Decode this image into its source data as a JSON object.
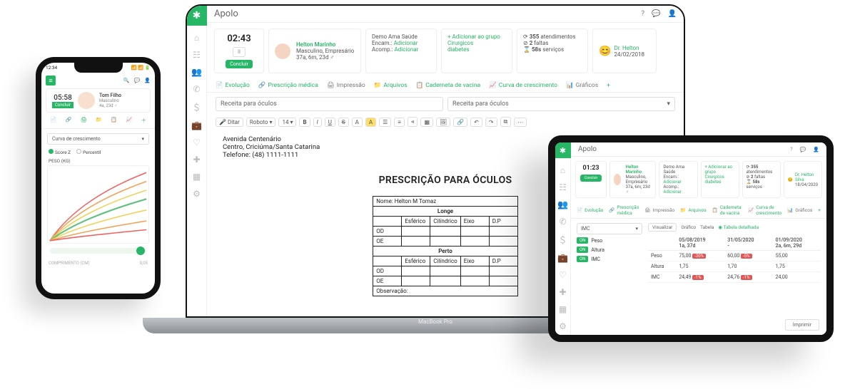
{
  "laptop": {
    "base_label": "MacBook Pro",
    "app_title": "Apolo",
    "sidebar_icons": [
      "home",
      "calendar",
      "users",
      "phone",
      "dollar",
      "briefcase",
      "heart",
      "health",
      "grid",
      "gear"
    ],
    "timer_card": {
      "time": "02:43",
      "pause": "II",
      "action": "Concluir"
    },
    "patient_card": {
      "name": "Helton Marinho",
      "details": "Masculino, Empresário",
      "age": "37a, 6m, 23d ♂"
    },
    "referral_card": {
      "l1": "Demo Ama Saúde",
      "l2a": "Encam.:",
      "l2b": "Adicionar",
      "l3a": "Acomp.:",
      "l3b": "Adicionar"
    },
    "group_card": {
      "add": "+ Adicionar ao grupo",
      "tag1": "Cirurgicos",
      "tag2": "diabetes"
    },
    "stats_card": {
      "i1": "⟳",
      "v1": "355",
      "t1": "atendimentos",
      "i2": "⊘",
      "v2": "2",
      "t2": "faltas",
      "i3": "⌛",
      "v3": "58s",
      "t3": "serviços"
    },
    "doctor_card": {
      "name": "Dr. Helton",
      "date": "24/02/2018"
    },
    "menu_tabs": {
      "evolucao": "Evolução",
      "prescricao": "Prescrição médica",
      "impressao": "Impressão",
      "arquivos": "Arquivos",
      "caderneta": "Caderneta de vacina",
      "curva": "Curva de crescimento",
      "graficos": "Gráficos",
      "add": "+"
    },
    "doc_title_input": "Receita para óculos",
    "doc_template_select": "Receita para óculos",
    "toolbar": {
      "ditar": "Ditar",
      "font": "Roboto",
      "size": "14",
      "b": "B",
      "i": "I",
      "u": "U",
      "s": "S",
      "color": "A",
      "hl": "A"
    },
    "editor": {
      "addr1": "Avenida Centenário",
      "addr2": "Centro, Criciúma/Santa Catarina",
      "phone": "Telefone: (48) 1111-1111",
      "title": "PRESCRIÇÃO PARA ÓCULOS",
      "name_label": "Nome:",
      "name_value": "Helton M Tomaz",
      "sect_longe": "Longe",
      "sect_perto": "Perto",
      "cols": {
        "esf": "Esférico",
        "cil": "Cilíndrico",
        "eixo": "Eixo",
        "dp": "D.P"
      },
      "rows": {
        "od": "OD",
        "oe": "OE"
      },
      "obs": "Observação:"
    }
  },
  "tablet": {
    "app_title": "Apolo",
    "timer_card": {
      "time": "01:23",
      "action": "Concluir"
    },
    "patient_card": {
      "name": "Helton Marinho",
      "details": "Masculino, Empresário",
      "age": "37a, 6m, 23d ♂"
    },
    "referral_card": {
      "l1": "Demo Ama Saúde",
      "l2a": "Encam.:",
      "l2b": "Adicionar",
      "l3a": "Acomp.:",
      "l3b": "Adicionar"
    },
    "group_card": {
      "add": "+ Adicionar ao grupo",
      "tag1": "Cirurgicos",
      "tag2": "diabetes"
    },
    "stats_card": {
      "v1": "355",
      "t1": "atendimentos",
      "v2": "2",
      "t2": "faltas",
      "v3": "58s",
      "t3": "serviços"
    },
    "doctor_card": {
      "name": "Dr. Helton Silva",
      "date": "18/04/2020"
    },
    "menu_tabs": {
      "evolucao": "Evolução",
      "prescricao": "Prescrição médica",
      "impressao": "Impressão",
      "arquivos": "Arquivos",
      "caderneta": "Caderneta de vacina",
      "curva": "Curva de crescimento",
      "graficos": "Gráficos",
      "add": "+"
    },
    "select_value": "IMC",
    "view_switch": {
      "visualizar": "Visualizar",
      "grafico": "Gráfico",
      "tabela": "Tabela",
      "detalhada": "Tabela detalhada"
    },
    "tags": {
      "peso": "Peso",
      "altura": "Altura",
      "imc": "IMC",
      "on": "ON"
    },
    "table": {
      "headers": [
        "",
        "05/08/2019\n1a, 37d",
        "31/05/2020\n-",
        "01/09/2020\n2a, 6m, 29d"
      ],
      "rows": [
        {
          "label": "Peso",
          "c1": "75,00",
          "d1": "-20%",
          "c2": "60,00",
          "d2": "-5%",
          "c3": "55,00"
        },
        {
          "label": "Altura",
          "c1": "1,75",
          "d1": "",
          "c2": "1,70",
          "d2": "",
          "c3": "1,75"
        },
        {
          "label": "IMC",
          "c1": "24,49",
          "d1": "-1%",
          "c2": "24,76",
          "d2": "-1%",
          "c3": "24,00"
        }
      ]
    },
    "footer_btn": "Imprimir"
  },
  "phone": {
    "time": "12:34",
    "signal": "📶 📶 🔋",
    "timer_card": {
      "time": "05:58",
      "action": "Concluir"
    },
    "patient": {
      "name": "Tom Filho",
      "sex": "Masculino",
      "age": "4a, 23d ♂"
    },
    "combo": "Curva de crescimento",
    "radios": {
      "scorez": "Score Z",
      "percentil": "Percentil"
    },
    "chart_label": "PESO (KG)",
    "slider_val": "0,05",
    "footer": "COMPRIMENTO (CM)"
  }
}
